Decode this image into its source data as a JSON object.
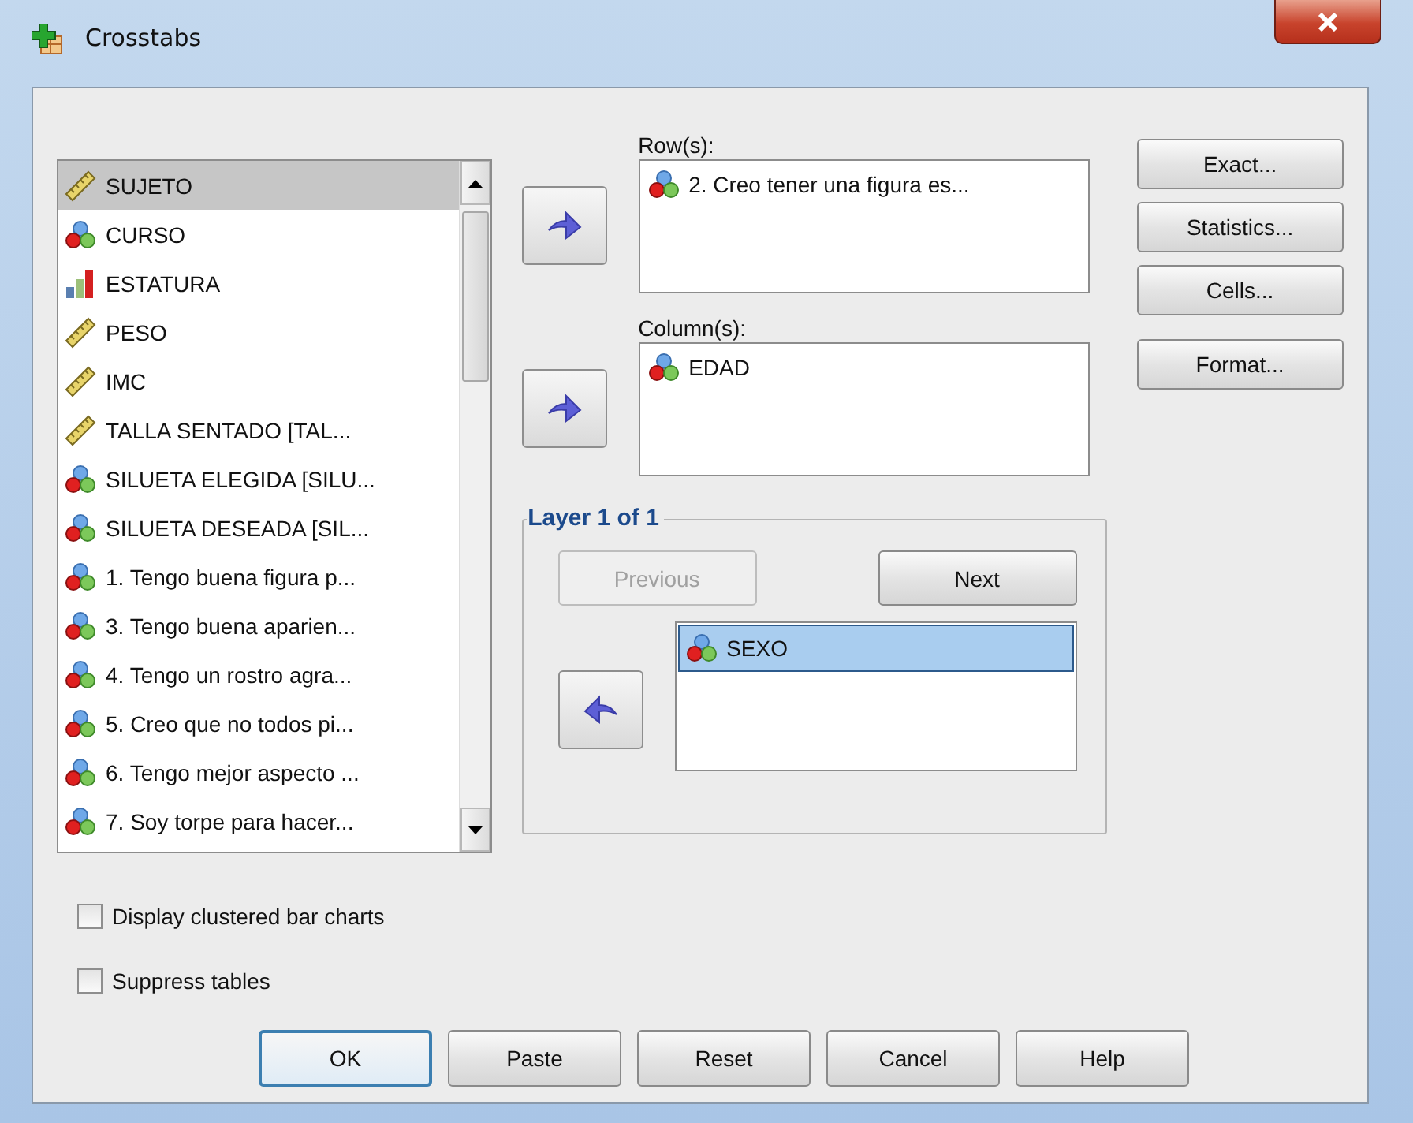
{
  "window": {
    "title": "Crosstabs"
  },
  "variables": [
    {
      "label": "SUJETO",
      "kind": "scale",
      "selected": true
    },
    {
      "label": "CURSO",
      "kind": "nominal",
      "selected": false
    },
    {
      "label": "ESTATURA",
      "kind": "ordinal",
      "selected": false
    },
    {
      "label": "PESO",
      "kind": "scale",
      "selected": false
    },
    {
      "label": "IMC",
      "kind": "scale",
      "selected": false
    },
    {
      "label": "TALLA SENTADO [TAL...",
      "kind": "scale",
      "selected": false
    },
    {
      "label": "SILUETA ELEGIDA [SILU...",
      "kind": "nominal",
      "selected": false
    },
    {
      "label": "SILUETA DESEADA [SIL...",
      "kind": "nominal",
      "selected": false
    },
    {
      "label": "1. Tengo buena figura p...",
      "kind": "nominal",
      "selected": false
    },
    {
      "label": "3. Tengo buena aparien...",
      "kind": "nominal",
      "selected": false
    },
    {
      "label": "4. Tengo un rostro agra...",
      "kind": "nominal",
      "selected": false
    },
    {
      "label": "5. Creo que no todos pi...",
      "kind": "nominal",
      "selected": false
    },
    {
      "label": "6. Tengo mejor aspecto ...",
      "kind": "nominal",
      "selected": false
    },
    {
      "label": "7. Soy torpe para hacer...",
      "kind": "nominal",
      "selected": false
    }
  ],
  "rows": {
    "label": "Row(s):",
    "reverse": false,
    "items": [
      {
        "label": "2. Creo tener una figura es...",
        "kind": "nominal",
        "selected": false
      }
    ]
  },
  "columns": {
    "label": "Column(s):",
    "reverse": false,
    "items": [
      {
        "label": "EDAD",
        "kind": "nominal",
        "selected": false
      }
    ]
  },
  "layer": {
    "title": "Layer 1 of 1",
    "reverse": true,
    "previous": {
      "label": "Previous",
      "disabled": true
    },
    "next": {
      "label": "Next",
      "disabled": false
    },
    "items": [
      {
        "label": "SEXO",
        "kind": "nominal",
        "selected": true
      }
    ]
  },
  "side_buttons": [
    "Exact...",
    "Statistics...",
    "Cells...",
    "Format..."
  ],
  "options": [
    {
      "label": "Display clustered bar charts",
      "checked": false
    },
    {
      "label": "Suppress tables",
      "checked": false
    }
  ],
  "buttons": [
    {
      "label": "OK",
      "default": true
    },
    {
      "label": "Paste",
      "default": false
    },
    {
      "label": "Reset",
      "default": false
    },
    {
      "label": "Cancel",
      "default": false
    },
    {
      "label": "Help",
      "default": false
    }
  ]
}
